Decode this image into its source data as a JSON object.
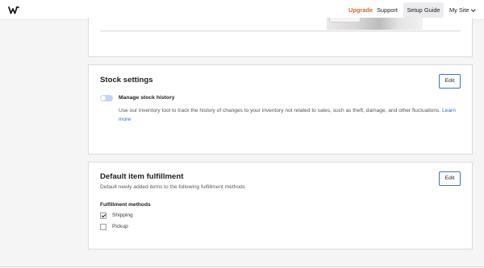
{
  "topbar": {
    "logo_icon": "weebly-w-logo",
    "upgrade_label": "Upgrade",
    "upgrade_color": "#e8622c",
    "support_label": "Support",
    "setup_label": "Setup Guide",
    "site_label": "My Site"
  },
  "stock": {
    "title": "Stock settings",
    "edit_label": "Edit",
    "toggle_on": true,
    "toggle_label": "Manage stock history",
    "description": "Use our inventory tool to track the history of changes to your inventory not related to sales, such as theft, damage, and other fluctuations.",
    "learn_more": "Learn more"
  },
  "fulfillment": {
    "title": "Default item fulfillment",
    "subtitle": "Default newly added items to the following fulfillment methods",
    "edit_label": "Edit",
    "methods_label": "Fulfillment methods",
    "methods": [
      {
        "label": "Shipping",
        "checked": true
      },
      {
        "label": "Pickup",
        "checked": false
      }
    ]
  },
  "colors": {
    "accent": "#3a6fe0",
    "link": "#2d68e8",
    "toggle": "#bfd6fa"
  }
}
